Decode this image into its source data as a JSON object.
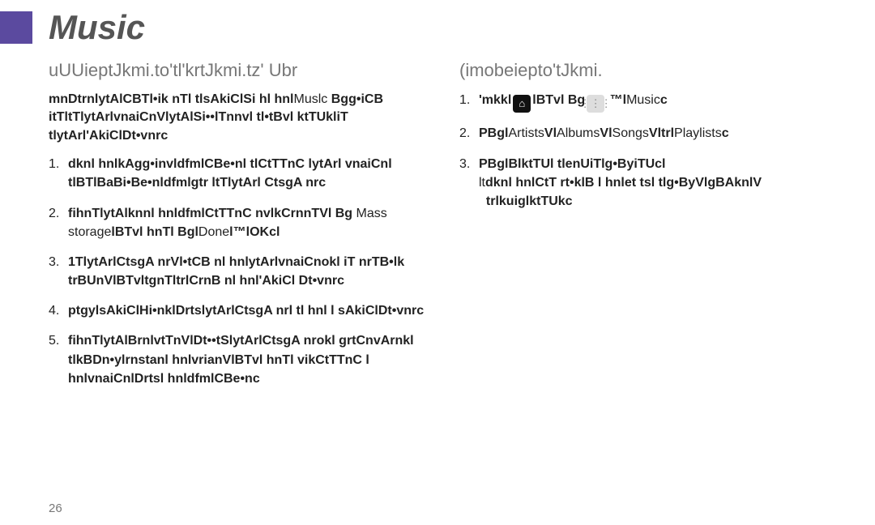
{
  "title": "Music",
  "left": {
    "heading": "uUUieptJkmi.to'tl'krtJkmi.tz' Ubr",
    "intro_bold_a": "mnDtrnlytAlCBTl•ik nTl tlsAkiClSi hl hnl",
    "intro_reg_a": "Muslc ",
    "intro_bold_b": "Bgg•iCB itTltTlytArlvnaiCnVlytAlSi••lTnnvl tl•tBvl ktTUkliT tlytArl'AkiClDt•vnrc",
    "items": [
      {
        "parts": [
          {
            "t": "b",
            "v": "dknl hnlkAgg•invldfmlCBe•nl tlCtTTnC lytArl vnaiCnl tlBTlBaBi•Be•nldfmlgtr ltTlytArl CtsgA nrc"
          }
        ]
      },
      {
        "parts": [
          {
            "t": "b",
            "v": "fihnTlytAlknnl hnldfmlCtTTnC nvlkCrnnTVl Bg "
          },
          {
            "t": "r",
            "v": "Mass storage"
          },
          {
            "t": "b",
            "v": "lBTvl hnTl Bgl"
          },
          {
            "t": "r",
            "v": "Done"
          },
          {
            "t": "b",
            "v": "l™lOKcl"
          }
        ]
      },
      {
        "parts": [
          {
            "t": "b",
            "v": "1TlytArlCtsgA nrVl•tCB nl hnlytArlvnaiCnokl iT nrTB•lk trBUnVlBTvltgnTltrlCrnB nl hnl'AkiCl Dt•vnrc"
          }
        ]
      },
      {
        "parts": [
          {
            "t": "b",
            "v": "ptgylsAkiClHi•nklDrtslytArlCtsgA nrl tl hnl l sAkiClDt•vnrc"
          }
        ]
      },
      {
        "parts": [
          {
            "t": "b",
            "v": "fihnTlytAlBrnlvtTnVlDt••tSlytArlCtsgA nrokl grtCnvArnkl tlkBDn•ylrnstanl hnlvrianVlBTvl hnTl vikCtTTnC l hnlvnaiCnlDrtsl hnldfmlCBe•nc"
          }
        ]
      }
    ]
  },
  "right": {
    "heading": "(imobeiepto'tJkmi.",
    "items": [
      {
        "kind": "iconline",
        "a": "'mkkl",
        "b": "lBTvl Bg",
        "c": "™l",
        "d": "Music",
        "e": "c"
      },
      {
        "parts": [
          {
            "t": "b",
            "v": "PBgl"
          },
          {
            "t": "r",
            "v": "Artists"
          },
          {
            "t": "b",
            "v": "Vl"
          },
          {
            "t": "r",
            "v": "Albums"
          },
          {
            "t": "b",
            "v": "Vl"
          },
          {
            "t": "r",
            "v": "Songs"
          },
          {
            "t": "b",
            "v": "Vltrl"
          },
          {
            "t": "r",
            "v": "Playlists"
          },
          {
            "t": "b",
            "v": "c"
          }
        ]
      },
      {
        "parts": [
          {
            "t": "b",
            "v": "PBglBlktTUl tlenUiTlg•ByiTUcl"
          },
          {
            "t": "br"
          },
          {
            "t": "r",
            "v": "lt"
          },
          {
            "t": "b",
            "v": "dknl hnlCtT rt•klB l hnlet  tsl tlg•ByVlgBAknlV"
          },
          {
            "t": "br"
          },
          {
            "t": "b",
            "v": "  trlkuiglktTUkc"
          }
        ]
      }
    ]
  },
  "page_number": "26",
  "icons": {
    "home_glyph": "⌂",
    "grid_glyph": "⋮⋮⋮"
  }
}
